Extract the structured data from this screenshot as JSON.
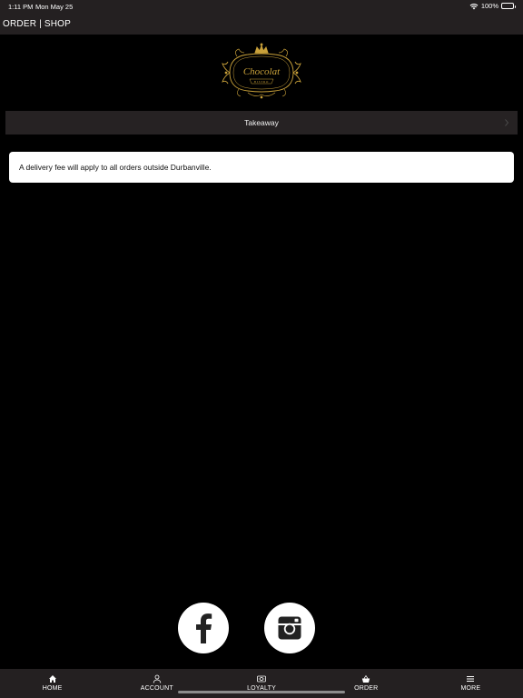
{
  "status_bar": {
    "time": "1:11 PM",
    "date": "Mon May 25",
    "battery": "100%",
    "icons": [
      "wifi-icon",
      "battery-icon"
    ]
  },
  "header": {
    "title": "ORDER | SHOP"
  },
  "logo": {
    "text": "Chocolat",
    "subtext": "BISTRO",
    "color": "#c9a13a"
  },
  "order_type": {
    "value": "Takeaway"
  },
  "notice": {
    "text": "A delivery fee will apply to all orders outside Durbanville."
  },
  "social": [
    {
      "name": "facebook",
      "icon": "facebook-icon"
    },
    {
      "name": "instagram",
      "icon": "instagram-icon"
    }
  ],
  "tabs": [
    {
      "label": "HOME",
      "icon": "home-icon"
    },
    {
      "label": "ACCOUNT",
      "icon": "user-icon"
    },
    {
      "label": "LOYALTY",
      "icon": "loyalty-icon"
    },
    {
      "label": "ORDER",
      "icon": "basket-icon"
    },
    {
      "label": "MORE",
      "icon": "menu-icon"
    }
  ],
  "colors": {
    "bar_background": "#242021",
    "page_background": "#000000",
    "accent_gold": "#c9a13a"
  }
}
